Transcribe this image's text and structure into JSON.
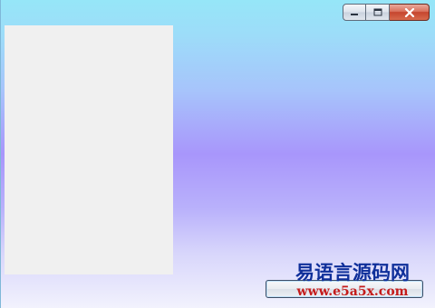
{
  "window": {
    "gradient_colors": [
      "#96e6f8",
      "#a7c4fb",
      "#a896fb",
      "#d8d6fb",
      "#f2f2fd"
    ],
    "caption_buttons": {
      "minimize_icon": "minimize-icon",
      "maximize_icon": "maximize-icon",
      "close_icon": "close-icon"
    }
  },
  "panel": {
    "background": "#f0f0f0"
  },
  "button": {
    "label": ""
  },
  "watermark": {
    "title": "易语言源码网",
    "url": "www.e5a5x.com"
  }
}
